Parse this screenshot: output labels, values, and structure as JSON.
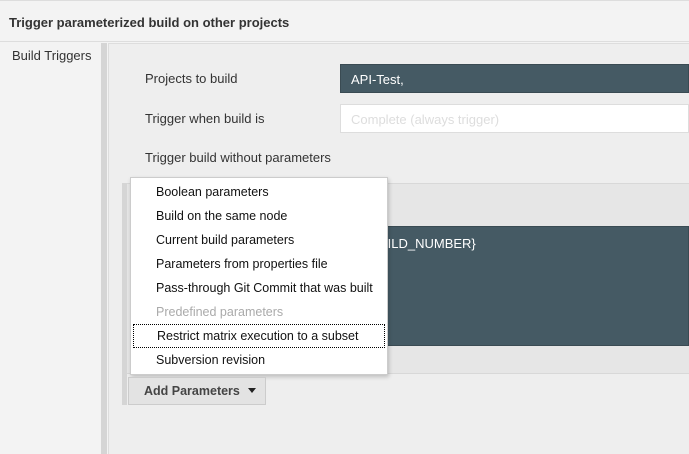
{
  "section_title": "Trigger parameterized build on other projects",
  "sidebar_label": "Build Triggers",
  "fields": {
    "projects_label": "Projects to build",
    "projects_value": "API-Test,",
    "trigger_label": "Trigger when build is",
    "trigger_value": "Complete (always trigger)",
    "without_params_label": "Trigger build without parameters"
  },
  "textarea_value": "${BUILD_NUMBER}",
  "menu": {
    "items": [
      {
        "label": "Boolean parameters"
      },
      {
        "label": "Build on the same node"
      },
      {
        "label": "Current build parameters"
      },
      {
        "label": "Parameters from properties file"
      },
      {
        "label": "Pass-through Git Commit that was built"
      },
      {
        "label": "Predefined parameters",
        "disabled": true
      },
      {
        "label": "Restrict matrix execution to a subset",
        "focused": true
      },
      {
        "label": "Subversion revision"
      }
    ]
  },
  "add_button_label": "Add Parameters"
}
